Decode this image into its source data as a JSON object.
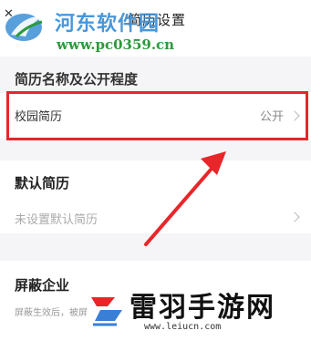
{
  "header": {
    "title": "简历设置",
    "back_icon": "close-icon"
  },
  "watermark_top": {
    "site_name": "河东软件园",
    "url": "www.pc0359.cn"
  },
  "section_public": {
    "title": "简历名称及公开程度",
    "row": {
      "label": "校园简历",
      "value": "公开"
    }
  },
  "section_default": {
    "title": "默认简历",
    "row": {
      "label": "未设置默认简历"
    }
  },
  "section_block": {
    "title": "屏蔽企业",
    "note": "屏蔽生效后，被屏"
  },
  "watermark_bottom": {
    "brand_name": "雷羽手游网",
    "url": "www.leiucn.com"
  },
  "colors": {
    "highlight": "#e8262a",
    "watermark_blue": "#3a8fd6",
    "watermark_green": "#2c9a3c"
  }
}
